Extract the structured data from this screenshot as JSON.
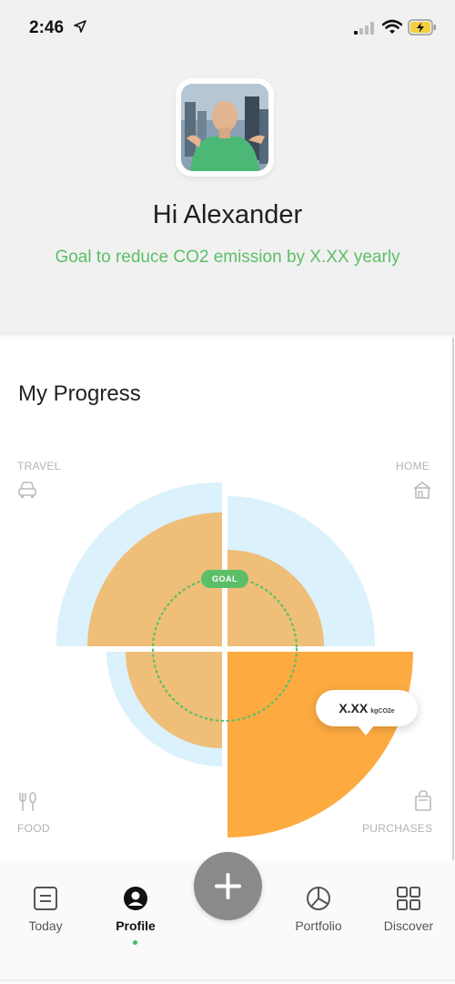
{
  "status_bar": {
    "time": "2:46",
    "icons": [
      "location-arrow-icon",
      "cellular-signal-icon",
      "wifi-icon",
      "battery-charging-icon"
    ]
  },
  "profile": {
    "greeting": "Hi Alexander",
    "goal": "Goal to reduce CO2 emission by X.XX yearly"
  },
  "progress": {
    "title": "My Progress",
    "categories": {
      "travel": "TRAVEL",
      "home": "HOME",
      "food": "FOOD",
      "purchases": "PURCHASES"
    },
    "goal_badge": "GOAL",
    "value_bubble": {
      "value": "X.XX",
      "unit": "kgCO2e"
    },
    "colors": {
      "goal_ring": "#dbf1fc",
      "progress": "#efbe79",
      "progress_inner": "#f0c27f",
      "highlight": "#fdab40",
      "goal_line": "#5cbf68"
    }
  },
  "tab_bar": {
    "tabs": [
      {
        "label": "Today",
        "icon": "today-list-icon"
      },
      {
        "label": "Profile",
        "icon": "profile-icon"
      },
      {
        "label": "Portfolio",
        "icon": "portfolio-pie-icon"
      },
      {
        "label": "Discover",
        "icon": "discover-grid-icon"
      }
    ],
    "active_tab": "Profile",
    "add_icon": "plus-icon"
  }
}
